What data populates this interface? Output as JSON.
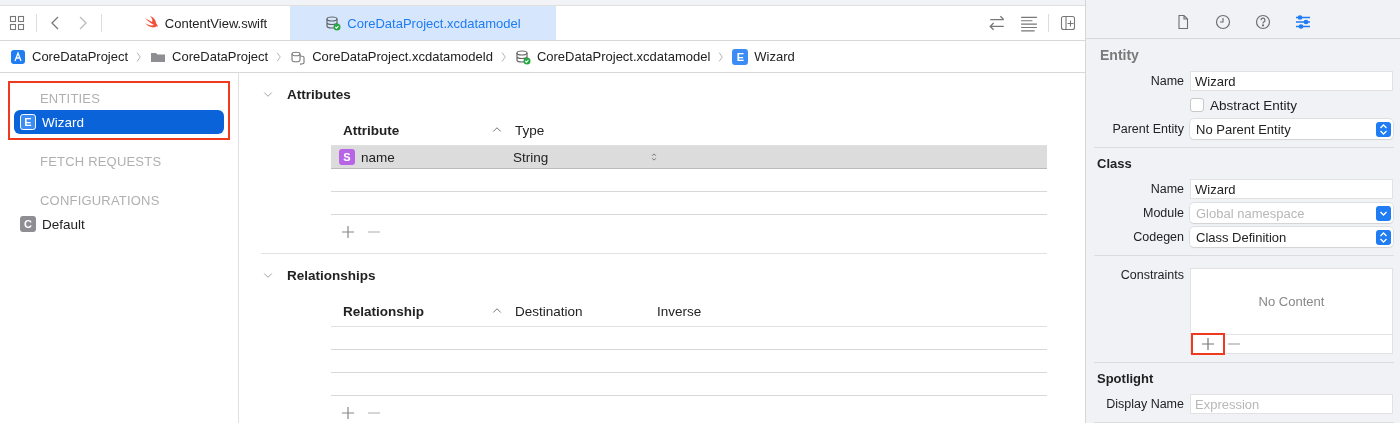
{
  "tabs": [
    {
      "label": "ContentView.swift",
      "kind": "swift",
      "selected": false
    },
    {
      "label": "CoreDataProject.xcdatamodel",
      "kind": "model",
      "selected": true
    }
  ],
  "breadcrumb": [
    {
      "label": "CoreDataProject",
      "kind": "app"
    },
    {
      "label": "CoreDataProject",
      "kind": "folder"
    },
    {
      "label": "CoreDataProject.xcdatamodeld",
      "kind": "modeld"
    },
    {
      "label": "CoreDataProject.xcdatamodel",
      "kind": "model"
    },
    {
      "label": "Wizard",
      "kind": "entity",
      "badge": "E"
    }
  ],
  "sidebar": {
    "sections": [
      {
        "heading": "ENTITIES",
        "highlighted": true,
        "items": [
          {
            "badge": "E",
            "color": "#3b8cf5",
            "label": "Wizard",
            "selected": true
          }
        ]
      },
      {
        "heading": "FETCH REQUESTS",
        "highlighted": false
      },
      {
        "heading": "CONFIGURATIONS",
        "highlighted": false,
        "items": [
          {
            "badge": "C",
            "color": "#8e8e93",
            "label": "Default",
            "selected": false
          }
        ]
      }
    ]
  },
  "editor": {
    "sections": [
      {
        "title": "Attributes",
        "expanded": true,
        "columns": [
          "Attribute",
          "Type"
        ],
        "rows": [
          {
            "badge": "S",
            "color": "#b765e6",
            "name": "name",
            "type": "String",
            "selected": true
          }
        ]
      },
      {
        "title": "Relationships",
        "expanded": true,
        "columns": [
          "Relationship",
          "Destination",
          "Inverse"
        ]
      }
    ]
  },
  "inspector": {
    "tabs": [
      {
        "kind": "file",
        "selected": false
      },
      {
        "kind": "history",
        "selected": false
      },
      {
        "kind": "help",
        "selected": false
      },
      {
        "kind": "attributes",
        "selected": true
      }
    ],
    "sections": [
      {
        "title": "Entity",
        "rows": [
          {
            "kind": "text",
            "label": "Name",
            "value": "Wizard"
          },
          {
            "kind": "checkbox",
            "text": "Abstract Entity",
            "checked": false
          },
          {
            "kind": "popup",
            "label": "Parent Entity",
            "value": "No Parent Entity",
            "disabled": false
          }
        ]
      },
      {
        "title": "Class",
        "rows": [
          {
            "kind": "text",
            "label": "Name",
            "value": "Wizard"
          },
          {
            "kind": "popup",
            "label": "Module",
            "placeholder": "Global namespace",
            "disabled": true
          },
          {
            "kind": "popup",
            "label": "Codegen",
            "value": "Class Definition",
            "disabled": false
          }
        ]
      },
      {
        "rows": [
          {
            "kind": "list",
            "label": "Constraints",
            "empty_text": "No Content",
            "add_highlighted": true
          }
        ]
      },
      {
        "title": "Spotlight",
        "rows": [
          {
            "kind": "text",
            "label": "Display Name",
            "placeholder": "Expression"
          }
        ]
      }
    ]
  }
}
